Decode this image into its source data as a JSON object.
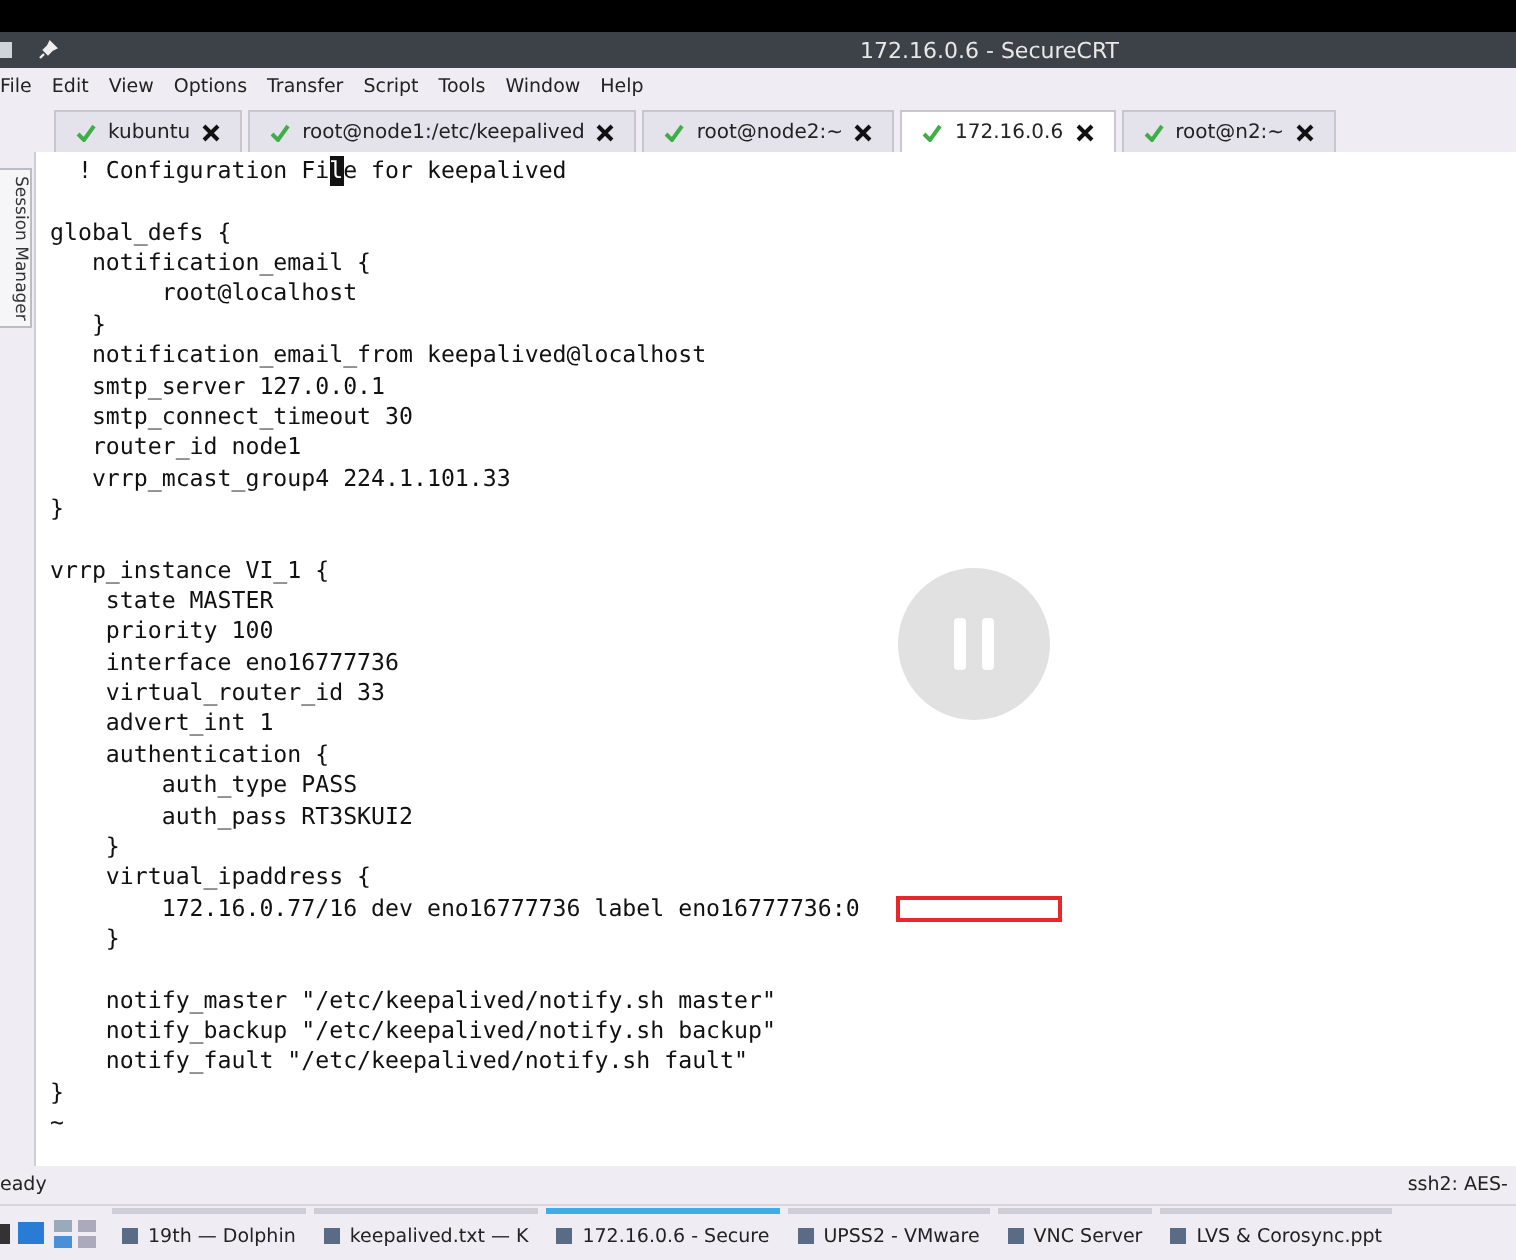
{
  "window": {
    "title": "172.16.0.6 - SecureCRT"
  },
  "menu": [
    "File",
    "Edit",
    "View",
    "Options",
    "Transfer",
    "Script",
    "Tools",
    "Window",
    "Help"
  ],
  "tabs": [
    {
      "label": "kubuntu",
      "selected": false
    },
    {
      "label": "root@node1:/etc/keepalived",
      "selected": false
    },
    {
      "label": "root@node2:~",
      "selected": false
    },
    {
      "label": "172.16.0.6",
      "selected": true
    },
    {
      "label": "root@n2:~",
      "selected": false
    }
  ],
  "side_panel": {
    "label": "Session Manager"
  },
  "terminal": {
    "lines": [
      {
        "kind": "segments",
        "segments": [
          {
            "text": "  ! Configuration Fi",
            "cursor": false
          },
          {
            "text": "l",
            "cursor": true
          },
          {
            "text": "e for keepalived",
            "cursor": false
          }
        ]
      },
      {
        "kind": "blank"
      },
      {
        "text": "global_defs {"
      },
      {
        "text": "   notification_email {"
      },
      {
        "text": "        root@localhost"
      },
      {
        "text": "   }"
      },
      {
        "text": "   notification_email_from keepalived@localhost"
      },
      {
        "text": "   smtp_server 127.0.0.1"
      },
      {
        "text": "   smtp_connect_timeout 30"
      },
      {
        "text": "   router_id node1"
      },
      {
        "text": "   vrrp_mcast_group4 224.1.101.33"
      },
      {
        "text": "}"
      },
      {
        "kind": "blank"
      },
      {
        "text": "vrrp_instance VI_1 {"
      },
      {
        "text": "    state MASTER"
      },
      {
        "text": "    priority 100"
      },
      {
        "text": "    interface eno16777736"
      },
      {
        "text": "    virtual_router_id 33"
      },
      {
        "text": "    advert_int 1"
      },
      {
        "text": "    authentication {"
      },
      {
        "text": "        auth_type PASS"
      },
      {
        "text": "        auth_pass RT3SKUI2"
      },
      {
        "text": "    }"
      },
      {
        "text": "    virtual_ipaddress {"
      },
      {
        "text": "        172.16.0.77/16 dev eno16777736 label eno16777736:0",
        "highlight_after": true
      },
      {
        "text": "    }"
      },
      {
        "kind": "blank"
      },
      {
        "text": "    notify_master \"/etc/keepalived/notify.sh master\""
      },
      {
        "text": "    notify_backup \"/etc/keepalived/notify.sh backup\""
      },
      {
        "text": "    notify_fault \"/etc/keepalived/notify.sh fault\""
      },
      {
        "text": "}"
      },
      {
        "text": "~"
      }
    ]
  },
  "status_bar": {
    "left": "eady",
    "right": "ssh2: AES-"
  },
  "taskbar": [
    {
      "label": "19th — Dolphin",
      "selected": false
    },
    {
      "label": "keepalived.txt — K",
      "selected": false
    },
    {
      "label": "172.16.0.6 - Secure",
      "selected": true
    },
    {
      "label": "UPSS2 - VMware",
      "selected": false
    },
    {
      "label": "VNC Server",
      "selected": false
    },
    {
      "label": "LVS & Corosync.ppt",
      "selected": false
    }
  ]
}
